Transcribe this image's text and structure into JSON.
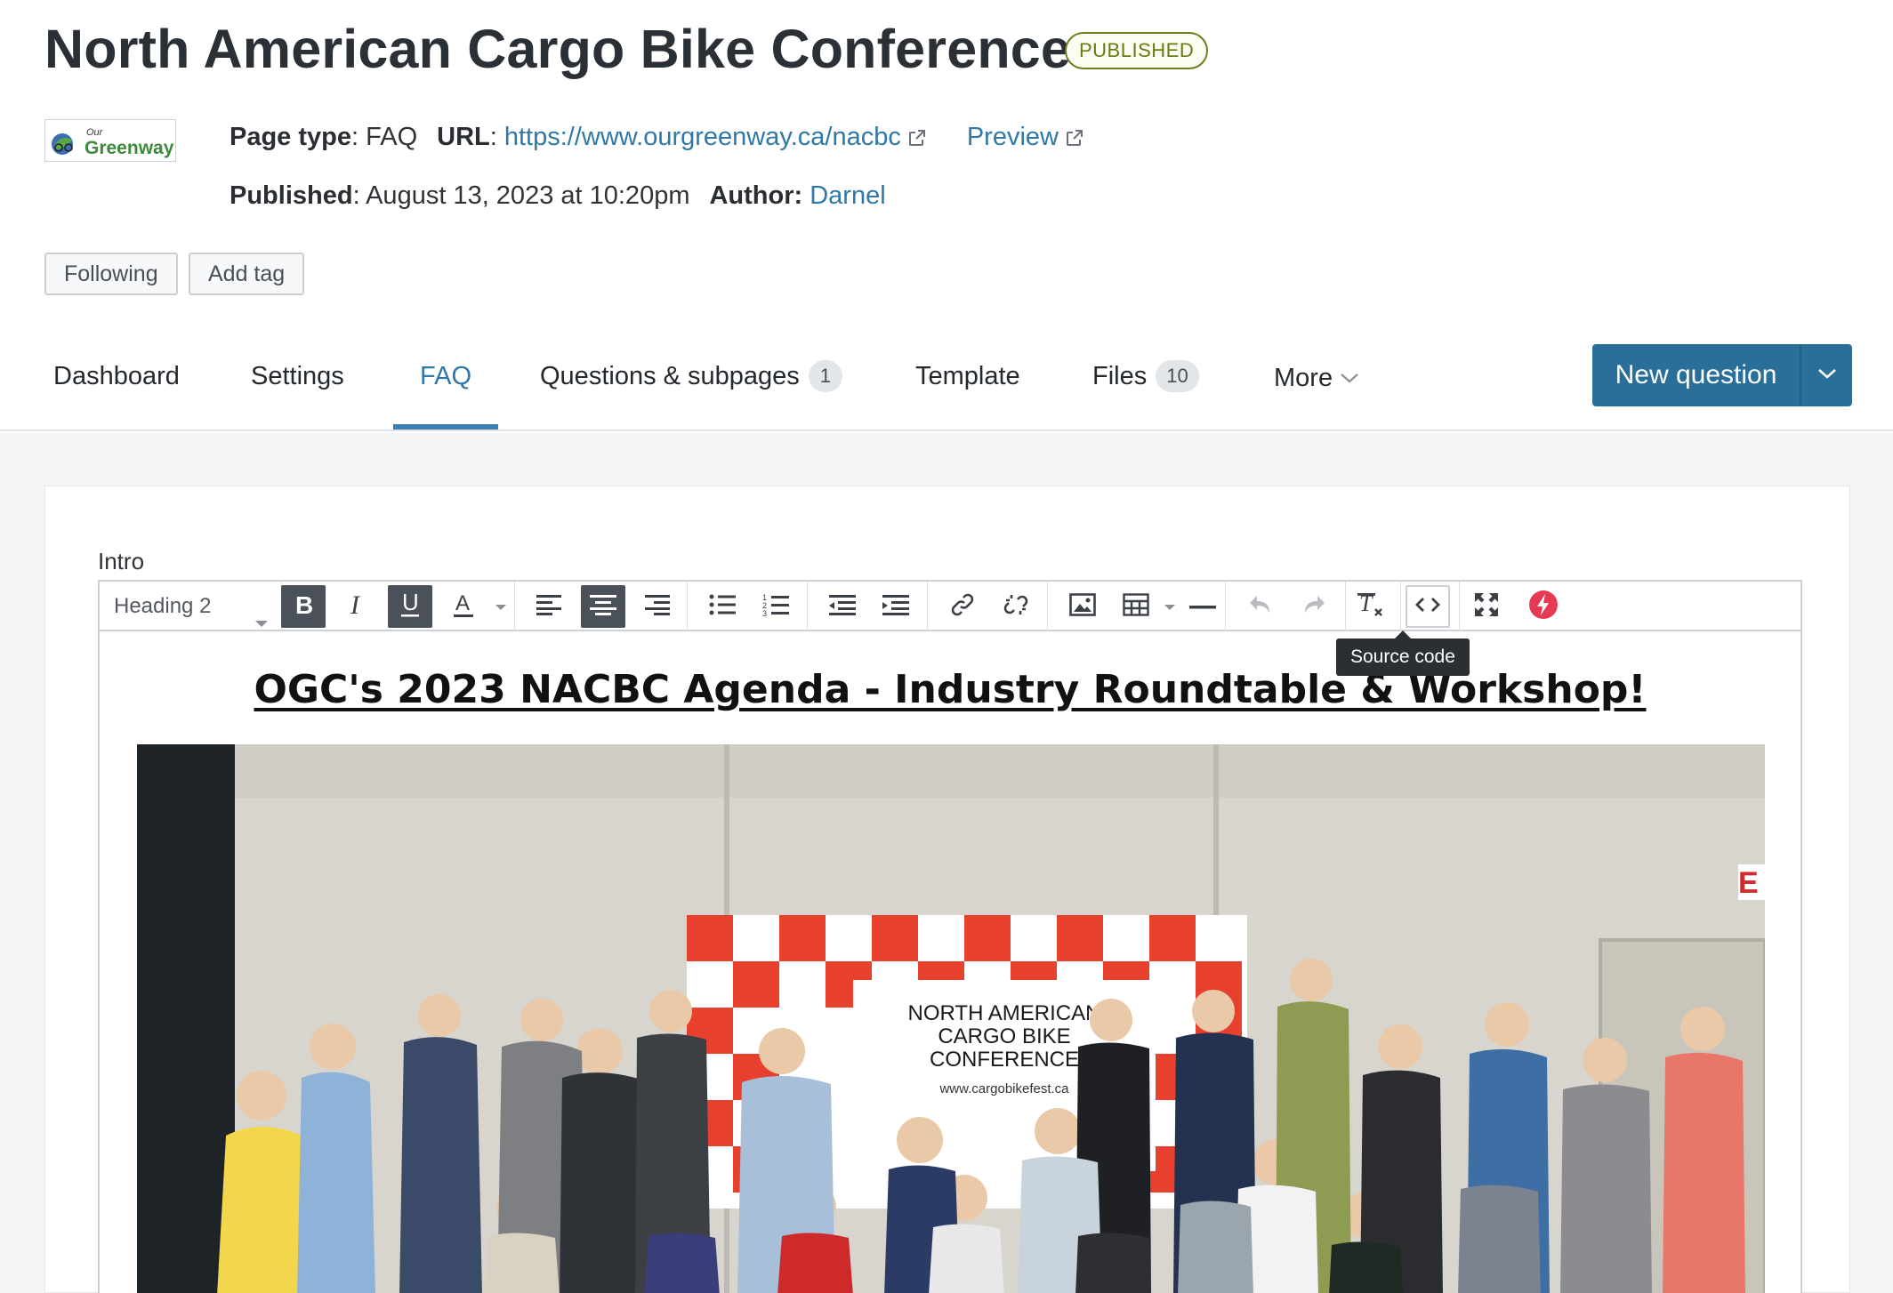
{
  "page": {
    "title": "North American Cargo Bike Conference",
    "status": "PUBLISHED"
  },
  "logo": {
    "alt_top": "Our",
    "alt_bottom": "Greenway"
  },
  "meta": {
    "page_type_label": "Page type",
    "page_type_value": "FAQ",
    "url_label": "URL",
    "url_value": "https://www.ourgreenway.ca/nacbc",
    "preview_label": "Preview",
    "published_label": "Published",
    "published_value": "August 13, 2023 at 10:20pm",
    "author_label": "Author:",
    "author_value": "Darnel"
  },
  "actions": {
    "following": "Following",
    "add_tag": "Add tag"
  },
  "tabs": [
    {
      "label": "Dashboard"
    },
    {
      "label": "Settings"
    },
    {
      "label": "FAQ"
    },
    {
      "label": "Questions & subpages",
      "count": "1"
    },
    {
      "label": "Template"
    },
    {
      "label": "Files",
      "count": "10"
    },
    {
      "label": "More"
    }
  ],
  "new_question": {
    "label": "New question"
  },
  "editor": {
    "field_label": "Intro",
    "block_format": "Heading 2",
    "tooltip": "Source code",
    "heading_text": "OGC's 2023 NACBC Agenda - Industry Roundtable & Workshop!"
  },
  "photo_banner": {
    "line1": "NORTH AMERICAN",
    "line2": "CARGO BIKE",
    "line3": "CONFERENCE",
    "site": "www.cargobikefest.ca"
  },
  "colors": {
    "link": "#2f78a8",
    "primary_button": "#2a6f99",
    "badge": "#6b7a12",
    "active_tab": "#3a80b0"
  }
}
